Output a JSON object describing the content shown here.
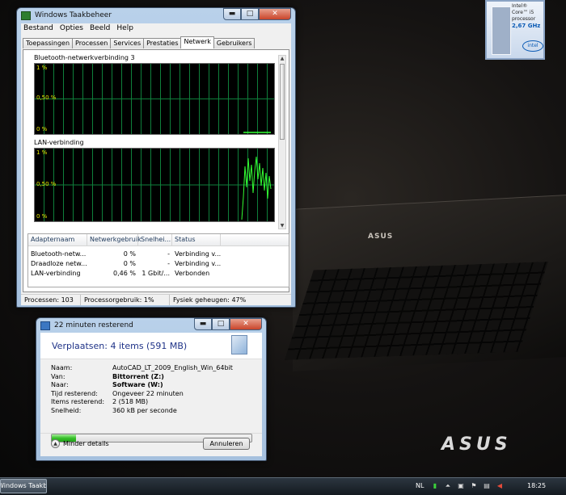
{
  "desktop": {
    "laptop_logo": "ASUS",
    "brand_logo": "ASUS",
    "intel_badge": {
      "line1": "Intel®",
      "line2": "Core™ i5",
      "line3": "processor",
      "speed": "2,67 GHz",
      "logo": "intel"
    }
  },
  "taskmanager": {
    "title": "Windows Taakbeheer",
    "controls": {
      "minimize": "▬",
      "maximize": "□",
      "close": "✕"
    },
    "menu": [
      "Bestand",
      "Opties",
      "Beeld",
      "Help"
    ],
    "tabs": [
      "Toepassingen",
      "Processen",
      "Services",
      "Prestaties",
      "Netwerk",
      "Gebruikers"
    ],
    "active_tab": "Netwerk",
    "graphs": [
      {
        "label": "Bluetooth-netwerkverbinding 3",
        "ticks": [
          "1 %",
          "0,50 %",
          "0 %"
        ]
      },
      {
        "label": "LAN-verbinding",
        "ticks": [
          "1 %",
          "0,50 %",
          "0 %"
        ]
      }
    ],
    "table": {
      "headers": [
        "Adapternaam",
        "Netwerkgebruik",
        "Snelhei...",
        "Status"
      ],
      "rows": [
        [
          "Bluetooth-netw...",
          "0 %",
          "-",
          "Verbinding v..."
        ],
        [
          "Draadloze netw...",
          "0 %",
          "-",
          "Verbinding v..."
        ],
        [
          "LAN-verbinding",
          "0,46 %",
          "1 Gbit/...",
          "Verbonden"
        ]
      ]
    },
    "status": {
      "processes": "Processen: 103",
      "cpu": "Processorgebruik: 1%",
      "memory": "Fysiek geheugen: 47%"
    }
  },
  "copydialog": {
    "title": "22 minuten resterend",
    "controls": {
      "minimize": "▬",
      "maximize": "□",
      "close": "✕"
    },
    "heading": "Verplaatsen: 4 items (591 MB)",
    "details": [
      {
        "label": "Naam:",
        "value": "AutoCAD_LT_2009_English_Win_64bit",
        "bold": false
      },
      {
        "label": "Van:",
        "value": "Bittorrent (Z:)",
        "bold": true
      },
      {
        "label": "Naar:",
        "value": "Software (W:)",
        "bold": true
      },
      {
        "label": "Tijd resterend:",
        "value": "Ongeveer 22 minuten",
        "bold": false
      },
      {
        "label": "Items resterend:",
        "value": "2 (518 MB)",
        "bold": false
      },
      {
        "label": "Snelheid:",
        "value": "360 kB per seconde",
        "bold": false
      }
    ],
    "progress_fraction": 0.12,
    "less_details": "Minder details",
    "cancel": "Annuleren"
  },
  "taskbar": {
    "task_button": "Windows Taakbeheer",
    "language": "NL",
    "clock": "18:25"
  },
  "colors": {
    "graph_grid": "#0f7f3b",
    "graph_line": "#33ff33",
    "tick_text": "#e6e600",
    "progress": "#37c02a"
  }
}
